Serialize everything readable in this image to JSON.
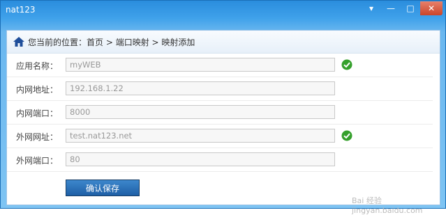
{
  "window": {
    "title": "nat123",
    "controls": {
      "menu_glyph": "▾",
      "minimize_glyph": "—",
      "maximize_glyph": "□",
      "close_glyph": "✕"
    }
  },
  "breadcrumb": {
    "prefix": "您当前的位置：",
    "items": [
      "首页",
      " > 端口映射",
      " > 映射添加"
    ]
  },
  "form": {
    "rows": [
      {
        "label": "应用名称：",
        "value": "myWEB",
        "valid": true
      },
      {
        "label": "内网地址：",
        "value": "192.168.1.22",
        "valid": false
      },
      {
        "label": "内网端口：",
        "value": "8000",
        "valid": false
      },
      {
        "label": "外网网址：",
        "value": "test.nat123.net",
        "valid": true
      },
      {
        "label": "外网端口：",
        "value": "80",
        "valid": false
      }
    ],
    "submit_label": "确认保存"
  },
  "watermark": "Bai 经验 jingyan.baidu.com",
  "colors": {
    "accent": "#2a8ddd",
    "valid_green": "#35a02c"
  }
}
